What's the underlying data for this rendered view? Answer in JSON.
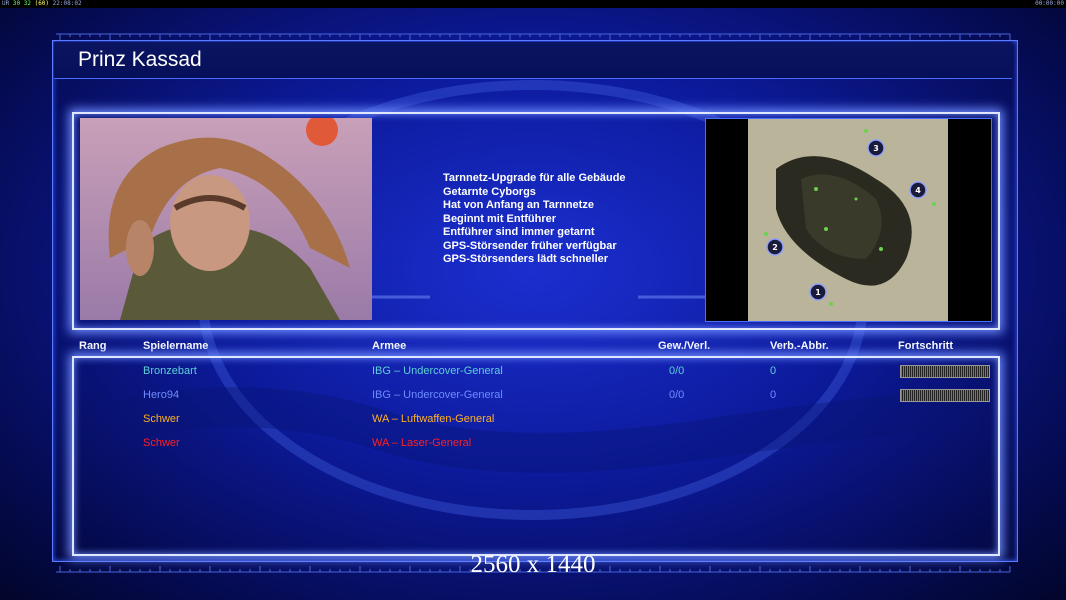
{
  "topbar": {
    "left_prefix": "UR",
    "left_a": "30",
    "left_b": "32",
    "left_c": "(60)",
    "left_time": "22:08:02",
    "right_time": "00:00:00"
  },
  "title": "Prinz Kassad",
  "perks": [
    "Tarnnetz-Upgrade für alle Gebäude",
    "Getarnte Cyborgs",
    "Hat von Anfang an Tarnnetze",
    "Beginnt mit Entführer",
    "Entführer sind immer getarnt",
    "GPS-Störsender früher verfügbar",
    "GPS-Störsenders lädt schneller"
  ],
  "minimap": {
    "start_positions": [
      "1",
      "2",
      "3",
      "4"
    ]
  },
  "table": {
    "headers": {
      "rank": "Rang",
      "player": "Spielername",
      "army": "Armee",
      "winloss": "Gew./Verl.",
      "disconnects": "Verb.-Abbr.",
      "progress": "Fortschritt"
    },
    "rows": [
      {
        "player": "Bronzebart",
        "army": "IBG – Undercover-General",
        "winloss": "0/0",
        "disconnects": "0",
        "has_progress": true,
        "color": "#5fd0d8",
        "army_color": "#5fd0d8"
      },
      {
        "player": "Hero94",
        "army": "IBG – Undercover-General",
        "winloss": "0/0",
        "disconnects": "0",
        "has_progress": true,
        "color": "#6f8cff",
        "army_color": "#6f8cff"
      },
      {
        "player": "Schwer",
        "army": "WA – Luftwaffen-General",
        "winloss": "",
        "disconnects": "",
        "has_progress": false,
        "color": "#ffb020",
        "army_color": "#ffb020"
      },
      {
        "player": "Schwer",
        "army": "WA – Laser-General",
        "winloss": "",
        "disconnects": "",
        "has_progress": false,
        "color": "#ff2020",
        "army_color": "#ff2020"
      }
    ]
  },
  "resolution_label": "2560 x 1440",
  "colors": {
    "accent_border": "#dfe6ff",
    "glow": "#6e8cff",
    "frame": "#5a7cff"
  }
}
